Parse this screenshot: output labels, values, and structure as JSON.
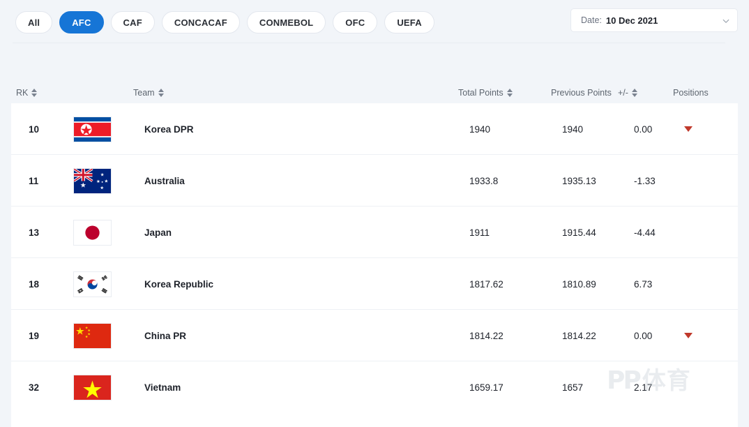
{
  "filters": {
    "confederations": [
      {
        "label": "All",
        "active": false
      },
      {
        "label": "AFC",
        "active": true
      },
      {
        "label": "CAF",
        "active": false
      },
      {
        "label": "CONCACAF",
        "active": false
      },
      {
        "label": "CONMEBOL",
        "active": false
      },
      {
        "label": "OFC",
        "active": false
      },
      {
        "label": "UEFA",
        "active": false
      }
    ],
    "active_color": "#1675d6"
  },
  "date_select": {
    "label": "Date:",
    "value": "10 Dec 2021",
    "chevron_icon": "chevron-down-icon"
  },
  "table": {
    "headers": {
      "rank": "RK",
      "team": "Team",
      "total_points": "Total Points",
      "previous_points": "Previous Points",
      "change": "+/-",
      "positions": "Positions"
    },
    "sortable": {
      "rank": true,
      "team": true,
      "total_points": true,
      "previous_points": false,
      "change": true,
      "positions": false
    },
    "rows": [
      {
        "rank": "10",
        "team": "Korea DPR",
        "flag": "flag-korea-dpr",
        "total_points": "1940",
        "previous_points": "1940",
        "change": "0.00",
        "position_change": "down"
      },
      {
        "rank": "11",
        "team": "Australia",
        "flag": "flag-australia",
        "total_points": "1933.8",
        "previous_points": "1935.13",
        "change": "-1.33",
        "position_change": "none"
      },
      {
        "rank": "13",
        "team": "Japan",
        "flag": "flag-japan",
        "total_points": "1911",
        "previous_points": "1915.44",
        "change": "-4.44",
        "position_change": "none"
      },
      {
        "rank": "18",
        "team": "Korea Republic",
        "flag": "flag-korea-republic",
        "total_points": "1817.62",
        "previous_points": "1810.89",
        "change": "6.73",
        "position_change": "none"
      },
      {
        "rank": "19",
        "team": "China PR",
        "flag": "flag-china-pr",
        "total_points": "1814.22",
        "previous_points": "1814.22",
        "change": "0.00",
        "position_change": "down"
      },
      {
        "rank": "32",
        "team": "Vietnam",
        "flag": "flag-vietnam",
        "total_points": "1659.17",
        "previous_points": "1657",
        "change": "2.17",
        "position_change": "none"
      }
    ],
    "down_color": "#c0392b"
  },
  "watermark": {
    "latin": "PP",
    "cjk": "体育"
  }
}
